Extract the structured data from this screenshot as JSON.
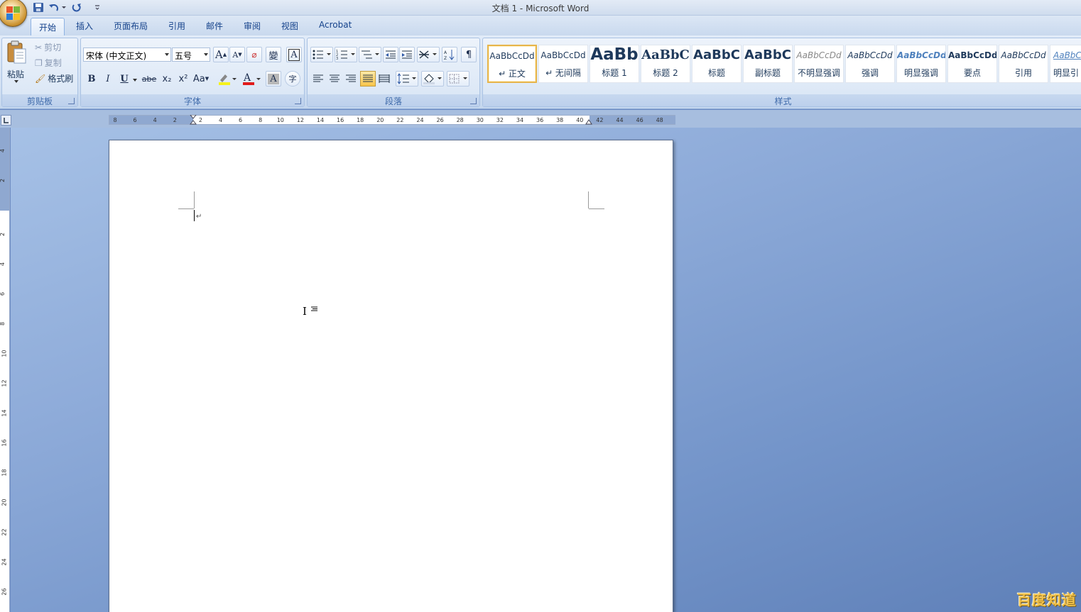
{
  "window": {
    "title": "文档 1 - Microsoft Word"
  },
  "tabs": [
    "开始",
    "插入",
    "页面布局",
    "引用",
    "邮件",
    "审阅",
    "视图",
    "Acrobat"
  ],
  "ribbon": {
    "clipboard": {
      "label": "剪贴板",
      "paste": "粘贴",
      "cut": "剪切",
      "copy": "复制",
      "format_painter": "格式刷"
    },
    "font": {
      "label": "字体",
      "font_name": "宋体 (中文正文)",
      "font_size": "五号",
      "bold": "B",
      "italic": "I",
      "underline": "U",
      "strikethrough": "abe",
      "subscript": "x₂",
      "superscript": "x²",
      "change_case": "Aa",
      "grow": "A",
      "shrink": "A",
      "phonetic": "變",
      "char_border": "A",
      "char_shading": "A",
      "enclose": "字"
    },
    "paragraph": {
      "label": "段落"
    },
    "styles": {
      "label": "样式",
      "items": [
        {
          "sample": "AaBbCcDd",
          "name": "↵ 正文"
        },
        {
          "sample": "AaBbCcDd",
          "name": "↵ 无间隔"
        },
        {
          "sample": "AaBb",
          "name": "标题 1"
        },
        {
          "sample": "AaBbC",
          "name": "标题 2"
        },
        {
          "sample": "AaBbC",
          "name": "标题"
        },
        {
          "sample": "AaBbC",
          "name": "副标题"
        },
        {
          "sample": "AaBbCcDd",
          "name": "不明显强调"
        },
        {
          "sample": "AaBbCcDd",
          "name": "强调"
        },
        {
          "sample": "AaBbCcDd",
          "name": "明显强调"
        },
        {
          "sample": "AaBbCcDd",
          "name": "要点"
        },
        {
          "sample": "AaBbCcDd",
          "name": "引用"
        },
        {
          "sample": "AaBbCc",
          "name": "明显引"
        }
      ]
    }
  },
  "ruler": {
    "h_ticks": [
      "8",
      "6",
      "4",
      "2",
      "2",
      "4",
      "6",
      "8",
      "10",
      "12",
      "14",
      "16",
      "18",
      "20",
      "22",
      "24",
      "26",
      "28",
      "30",
      "32",
      "34",
      "36",
      "38",
      "40",
      "42",
      "44",
      "46",
      "48"
    ],
    "v_ticks": [
      "4",
      "2",
      "2",
      "4",
      "6",
      "8",
      "10",
      "12",
      "14",
      "16",
      "18",
      "20",
      "22",
      "24",
      "26"
    ]
  },
  "document": {
    "paragraph_mark": "↵"
  },
  "watermark": "百度知道",
  "colors": {
    "accent": "#15428b",
    "doc_background": "#7394c9",
    "selected_style_border": "#e7b54b"
  }
}
